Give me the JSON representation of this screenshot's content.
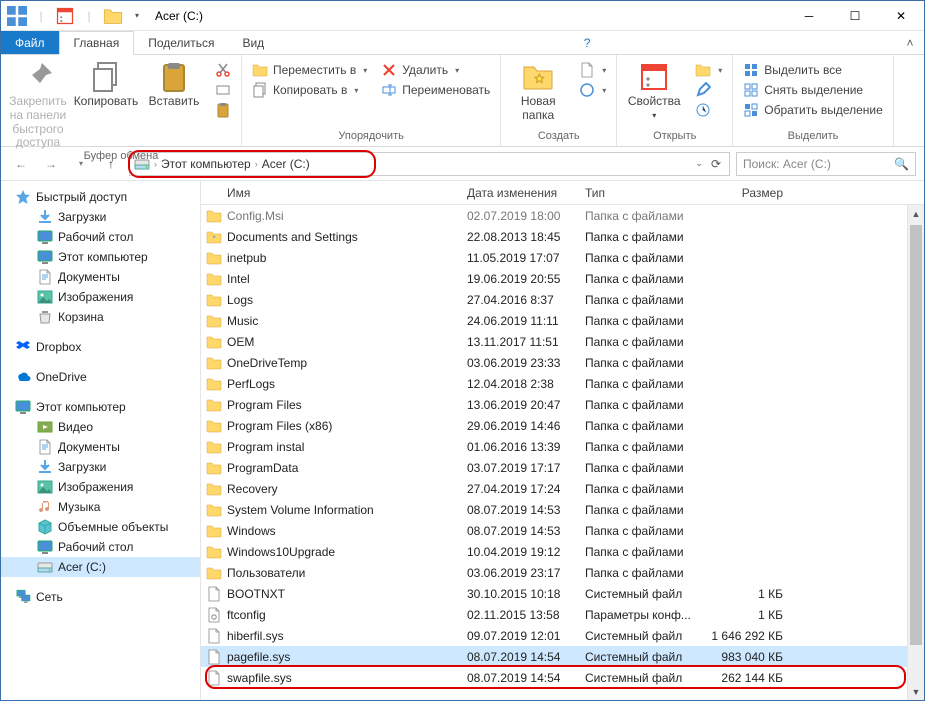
{
  "title": "Acer (C:)",
  "tabs": {
    "file": "Файл",
    "home": "Главная",
    "share": "Поделиться",
    "view": "Вид"
  },
  "ribbon": {
    "clipboard": {
      "pin": "Закрепить на панели быстрого доступа",
      "copy": "Копировать",
      "paste": "Вставить",
      "label": "Буфер обмена"
    },
    "organize": {
      "moveto": "Переместить в",
      "copyto": "Копировать в",
      "delete": "Удалить",
      "rename": "Переименовать",
      "label": "Упорядочить"
    },
    "new": {
      "newfolder": "Новая папка",
      "label": "Создать"
    },
    "open": {
      "properties": "Свойства",
      "label": "Открыть"
    },
    "select": {
      "all": "Выделить все",
      "none": "Снять выделение",
      "invert": "Обратить выделение",
      "label": "Выделить"
    }
  },
  "breadcrumb": {
    "root": "Этот компьютер",
    "drive": "Acer (C:)"
  },
  "search_placeholder": "Поиск: Acer (C:)",
  "columns": {
    "name": "Имя",
    "date": "Дата изменения",
    "type": "Тип",
    "size": "Размер"
  },
  "tree": {
    "quick": "Быстрый доступ",
    "downloads": "Загрузки",
    "desktop": "Рабочий стол",
    "thispc": "Этот компьютер",
    "documents": "Документы",
    "pictures": "Изображения",
    "recycle": "Корзина",
    "dropbox": "Dropbox",
    "onedrive": "OneDrive",
    "thispc2": "Этот компьютер",
    "videos": "Видео",
    "documents2": "Документы",
    "downloads2": "Загрузки",
    "pictures2": "Изображения",
    "music": "Музыка",
    "objects3d": "Объемные объекты",
    "desktop2": "Рабочий стол",
    "acer": "Acer (C:)",
    "network": "Сеть"
  },
  "files": [
    {
      "name": "Config.Msi",
      "date": "02.07.2019 18:00",
      "type": "Папка с файлами",
      "size": "",
      "icon": "folder",
      "dim": true
    },
    {
      "name": "Documents and Settings",
      "date": "22.08.2013 18:45",
      "type": "Папка с файлами",
      "size": "",
      "icon": "folder-link"
    },
    {
      "name": "inetpub",
      "date": "11.05.2019 17:07",
      "type": "Папка с файлами",
      "size": "",
      "icon": "folder"
    },
    {
      "name": "Intel",
      "date": "19.06.2019 20:55",
      "type": "Папка с файлами",
      "size": "",
      "icon": "folder"
    },
    {
      "name": "Logs",
      "date": "27.04.2016 8:37",
      "type": "Папка с файлами",
      "size": "",
      "icon": "folder"
    },
    {
      "name": "Music",
      "date": "24.06.2019 11:11",
      "type": "Папка с файлами",
      "size": "",
      "icon": "folder"
    },
    {
      "name": "OEM",
      "date": "13.11.2017 11:51",
      "type": "Папка с файлами",
      "size": "",
      "icon": "folder"
    },
    {
      "name": "OneDriveTemp",
      "date": "03.06.2019 23:33",
      "type": "Папка с файлами",
      "size": "",
      "icon": "folder"
    },
    {
      "name": "PerfLogs",
      "date": "12.04.2018 2:38",
      "type": "Папка с файлами",
      "size": "",
      "icon": "folder"
    },
    {
      "name": "Program Files",
      "date": "13.06.2019 20:47",
      "type": "Папка с файлами",
      "size": "",
      "icon": "folder"
    },
    {
      "name": "Program Files (x86)",
      "date": "29.06.2019 14:46",
      "type": "Папка с файлами",
      "size": "",
      "icon": "folder"
    },
    {
      "name": "Program instal",
      "date": "01.06.2016 13:39",
      "type": "Папка с файлами",
      "size": "",
      "icon": "folder"
    },
    {
      "name": "ProgramData",
      "date": "03.07.2019 17:17",
      "type": "Папка с файлами",
      "size": "",
      "icon": "folder"
    },
    {
      "name": "Recovery",
      "date": "27.04.2019 17:24",
      "type": "Папка с файлами",
      "size": "",
      "icon": "folder"
    },
    {
      "name": "System Volume Information",
      "date": "08.07.2019 14:53",
      "type": "Папка с файлами",
      "size": "",
      "icon": "folder"
    },
    {
      "name": "Windows",
      "date": "08.07.2019 14:53",
      "type": "Папка с файлами",
      "size": "",
      "icon": "folder"
    },
    {
      "name": "Windows10Upgrade",
      "date": "10.04.2019 19:12",
      "type": "Папка с файлами",
      "size": "",
      "icon": "folder"
    },
    {
      "name": "Пользователи",
      "date": "03.06.2019 23:17",
      "type": "Папка с файлами",
      "size": "",
      "icon": "folder"
    },
    {
      "name": "BOOTNXT",
      "date": "30.10.2015 10:18",
      "type": "Системный файл",
      "size": "1 КБ",
      "icon": "file"
    },
    {
      "name": "ftconfig",
      "date": "02.11.2015 13:58",
      "type": "Параметры конф...",
      "size": "1 КБ",
      "icon": "file-conf"
    },
    {
      "name": "hiberfil.sys",
      "date": "09.07.2019 12:01",
      "type": "Системный файл",
      "size": "1 646 292 КБ",
      "icon": "file"
    },
    {
      "name": "pagefile.sys",
      "date": "08.07.2019 14:54",
      "type": "Системный файл",
      "size": "983 040 КБ",
      "icon": "file",
      "selected": true
    },
    {
      "name": "swapfile.sys",
      "date": "08.07.2019 14:54",
      "type": "Системный файл",
      "size": "262 144 КБ",
      "icon": "file",
      "highlight": true
    }
  ]
}
